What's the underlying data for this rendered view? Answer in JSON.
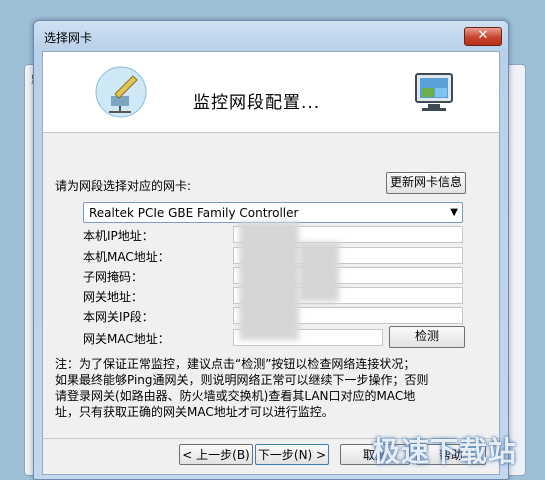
{
  "dialog": {
    "title": "选择网卡",
    "close_label": "✕",
    "header_title": "监控网段配置..."
  },
  "nic": {
    "prompt": "请为网段选择对应的网卡:",
    "refresh_label": "更新网卡信息",
    "selected": "Realtek PCIe GBE Family Controller"
  },
  "fields": [
    {
      "label": "本机IP地址："
    },
    {
      "label": "本机MAC地址："
    },
    {
      "label": "子网掩码："
    },
    {
      "label": "网关地址："
    },
    {
      "label": "本网关IP段："
    },
    {
      "label": "网关MAC地址："
    }
  ],
  "detect_label": "检测",
  "note_lines": [
    "注：为了保证正常监控，建议点击“检测”按钮以检查网络连接状况；",
    "如果最终能够Ping通网关，则说明网络正常可以继续下一步操作；否则",
    "请登录网关(如路由器、防火墙或交换机)查看其LAN口对应的MAC地",
    "址，只有获取正确的网关MAC地址才可以进行监控。"
  ],
  "buttons": {
    "back": "< 上一步(B)",
    "next": "下一步(N) >",
    "cancel": "取消",
    "help": "帮助"
  },
  "watermark": "极速下载站",
  "colors": {
    "accent": "#4a90c8",
    "close": "#c7422d"
  }
}
